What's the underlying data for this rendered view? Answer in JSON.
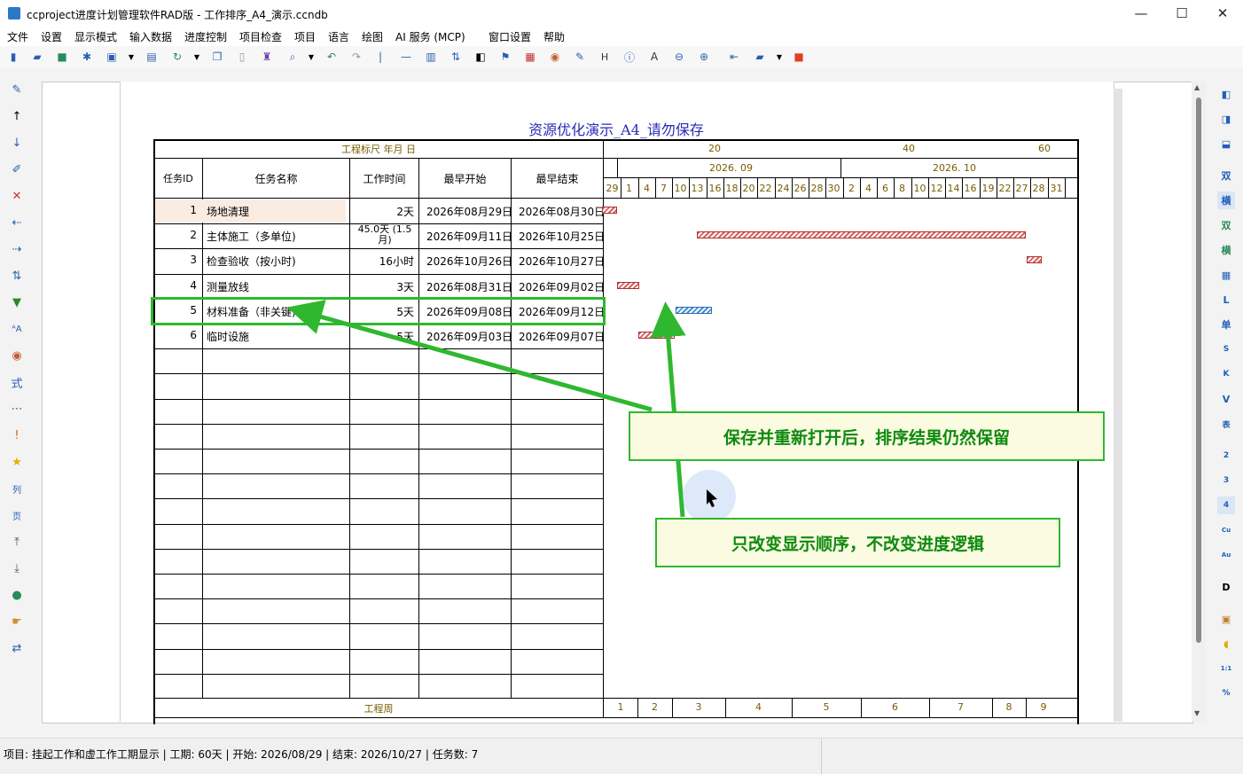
{
  "window": {
    "title": "ccproject进度计划管理软件RAD版 - 工作排序_A4_演示.ccndb",
    "minimize": "—",
    "maximize": "☐",
    "close": "✕"
  },
  "menu": [
    "文件",
    "设置",
    "显示模式",
    "输入数据",
    "进度控制",
    "项目检查",
    "项目",
    "语言",
    "绘图",
    "AI 服务 (MCP)",
    "窗口设置",
    "帮助"
  ],
  "right_toolbar": [
    "双",
    "横",
    "双",
    "横",
    "L",
    "单",
    "S",
    "K",
    "V",
    "表",
    "2",
    "3",
    "4",
    "Cu",
    "Au",
    "D",
    "1:1",
    "%"
  ],
  "chart": {
    "title": "资源优化演示_A4_请勿保存",
    "ruler_label": "工程标尺 年月 日",
    "ruler_ticks": [
      "20",
      "40",
      "60"
    ],
    "months": [
      "2026. 09",
      "2026. 10"
    ],
    "days": [
      "29",
      "1",
      "4",
      "7",
      "10",
      "13",
      "16",
      "18",
      "20",
      "22",
      "24",
      "26",
      "28",
      "30",
      "2",
      "4",
      "6",
      "8",
      "10",
      "12",
      "14",
      "16",
      "19",
      "22",
      "27",
      "28",
      "31"
    ],
    "columns": [
      "任务ID",
      "任务名称",
      "工作时间",
      "最早开始",
      "最早结束"
    ],
    "rows": [
      {
        "id": "1",
        "name": "场地清理",
        "duration": "2天",
        "start": "2026年08月29日",
        "end": "2026年08月30日",
        "bar_start_day": 0,
        "bar_days": 2,
        "critical": true
      },
      {
        "id": "2",
        "name": "主体施工（多单位)",
        "duration": "45.0天 (1.5月)",
        "start": "2026年09月11日",
        "end": "2026年10月25日",
        "bar_start_day": 13,
        "bar_days": 45,
        "critical": true
      },
      {
        "id": "3",
        "name": "检查验收（按小时)",
        "duration": "16小时",
        "start": "2026年10月26日",
        "end": "2026年10月27日",
        "bar_start_day": 58,
        "bar_days": 2,
        "critical": true
      },
      {
        "id": "4",
        "name": "测量放线",
        "duration": "3天",
        "start": "2026年08月31日",
        "end": "2026年09月02日",
        "bar_start_day": 2,
        "bar_days": 3,
        "critical": true
      },
      {
        "id": "5",
        "name": "材料准备（非关键)",
        "duration": "5天",
        "start": "2026年09月08日",
        "end": "2026年09月12日",
        "bar_start_day": 10,
        "bar_days": 5,
        "critical": false
      },
      {
        "id": "6",
        "name": "临时设施",
        "duration": "5天",
        "start": "2026年09月03日",
        "end": "2026年09月07日",
        "bar_start_day": 5,
        "bar_days": 5,
        "critical": true
      }
    ],
    "footer_label": "工程周",
    "weeks": [
      "1",
      "2",
      "3",
      "4",
      "5",
      "6",
      "7",
      "8",
      "9"
    ]
  },
  "callouts": {
    "top": "保存并重新打开后，排序结果仍然保留",
    "bottom": "只改变显示顺序，不改变进度逻辑"
  },
  "statusbar": {
    "text": "项目: 挂起工作和虚工作工期显示 | 工期: 60天 | 开始: 2026/08/29 | 结束: 2026/10/27 | 任务数: 7"
  },
  "colors": {
    "accent_green": "#2fb82f",
    "critical_bar": "#c84040",
    "noncritical_bar": "#3a7fc0",
    "title_blue": "#2a2ab8"
  }
}
